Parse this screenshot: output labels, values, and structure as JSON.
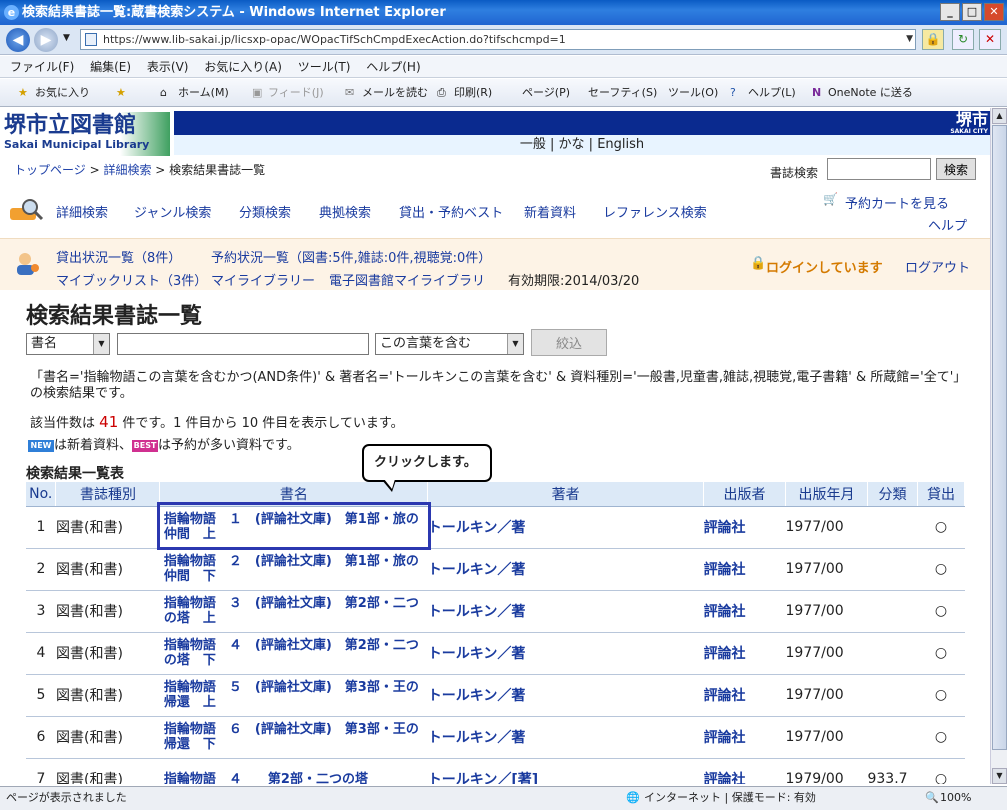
{
  "window": {
    "title": "検索結果書誌一覧:蔵書検索システム - Windows Internet Explorer"
  },
  "address": {
    "url": "https://www.lib-sakai.jp/licsxp-opac/WOpacTifSchCmpdExecAction.do?tifschcmpd=1"
  },
  "menu": [
    "ファイル(F)",
    "編集(E)",
    "表示(V)",
    "お気に入り(A)",
    "ツール(T)",
    "ヘルプ(H)"
  ],
  "favbar": {
    "favorites": "お気に入り",
    "home": "ホーム(M)",
    "feed": "フィード(J)",
    "mail": "メールを読む",
    "print": "印刷(R)",
    "page": "ページ(P)",
    "safety": "セーフティ(S)",
    "tools": "ツール(O)",
    "help": "ヘルプ(L)",
    "onenote": "OneNote に送る"
  },
  "site": {
    "logo_jp": "堺市立図書館",
    "logo_en": "Sakai Municipal Library",
    "city": "堺市",
    "city_en": "SAKAI CITY",
    "lang": [
      "一般",
      "かな",
      "English"
    ]
  },
  "breadcrumb": {
    "top": "トップページ",
    "detail": "詳細検索",
    "current": "検索結果書誌一覧"
  },
  "bibsearch": {
    "label": "書誌検索",
    "button": "検索"
  },
  "nav1": {
    "items": [
      "詳細検索",
      "ジャンル検索",
      "分類検索",
      "典拠検索",
      "貸出・予約ベスト",
      "新着資料",
      "レファレンス検索"
    ],
    "cart": "予約カートを見る",
    "help": "ヘルプ"
  },
  "nav2": {
    "lending": "貸出状況一覧（8件）",
    "reserve": "予約状況一覧（図書:5件,雑誌:0件,視聴覚:0件）",
    "booklist": "マイブックリスト（3件）",
    "mylib": "マイライブラリー",
    "ebook": "電子図書館マイライブラリ",
    "expiry": "有効期限:2014/03/20",
    "logged": "ログインしています",
    "logout": "ログアウト"
  },
  "page": {
    "title": "検索結果書誌一覧",
    "field_select": "書名",
    "match_select": "この言葉を含む",
    "filter_button": "絞込",
    "condition": "「書名='指輪物語この言葉を含むかつ(AND条件)' & 著者名='トールキンこの言葉を含む' & 資料種別='一般書,児童書,雑誌,視聴覚,電子書籍' & 所蔵館='全て'」の検索結果です。",
    "count_pre": "該当件数は",
    "count": "41",
    "count_post": "件です。1 件目から 10 件目を表示しています。",
    "legend_new": "は新着資料、",
    "legend_best": "は予約が多い資料です。",
    "badge_new": "NEW",
    "badge_best": "BEST",
    "table_title": "検索結果一覧表",
    "callout": "クリックします。"
  },
  "table": {
    "headers": [
      "No.",
      "書誌種別",
      "書名",
      "著者",
      "出版者",
      "出版年月",
      "分類",
      "貸出"
    ],
    "rows": [
      {
        "no": "1",
        "type": "図書(和書)",
        "title": "指輪物語　１　(評論社文庫)　第1部・旅の仲間　上",
        "author": "トールキン／著",
        "pub": "評論社",
        "date": "1977/00",
        "cls": "",
        "avail": "○"
      },
      {
        "no": "2",
        "type": "図書(和書)",
        "title": "指輪物語　２　(評論社文庫)　第1部・旅の仲間　下",
        "author": "トールキン／著",
        "pub": "評論社",
        "date": "1977/00",
        "cls": "",
        "avail": "○"
      },
      {
        "no": "3",
        "type": "図書(和書)",
        "title": "指輪物語　３　(評論社文庫)　第2部・二つの塔　上",
        "author": "トールキン／著",
        "pub": "評論社",
        "date": "1977/00",
        "cls": "",
        "avail": "○"
      },
      {
        "no": "4",
        "type": "図書(和書)",
        "title": "指輪物語　４　(評論社文庫)　第2部・二つの塔　下",
        "author": "トールキン／著",
        "pub": "評論社",
        "date": "1977/00",
        "cls": "",
        "avail": "○"
      },
      {
        "no": "5",
        "type": "図書(和書)",
        "title": "指輪物語　５　(評論社文庫)　第3部・王の帰還　上",
        "author": "トールキン／著",
        "pub": "評論社",
        "date": "1977/00",
        "cls": "",
        "avail": "○"
      },
      {
        "no": "6",
        "type": "図書(和書)",
        "title": "指輪物語　６　(評論社文庫)　第3部・王の帰還　下",
        "author": "トールキン／著",
        "pub": "評論社",
        "date": "1977/00",
        "cls": "",
        "avail": "○"
      },
      {
        "no": "7",
        "type": "図書(和書)",
        "title": "指輪物語　４　　第2部・二つの塔",
        "author": "トールキン／[著]",
        "pub": "評論社",
        "date": "1979/00",
        "cls": "933.7",
        "avail": "○"
      }
    ]
  },
  "status": {
    "left": "ページが表示されました",
    "zone": "インターネット | 保護モード: 有効",
    "zoom": "100%"
  }
}
